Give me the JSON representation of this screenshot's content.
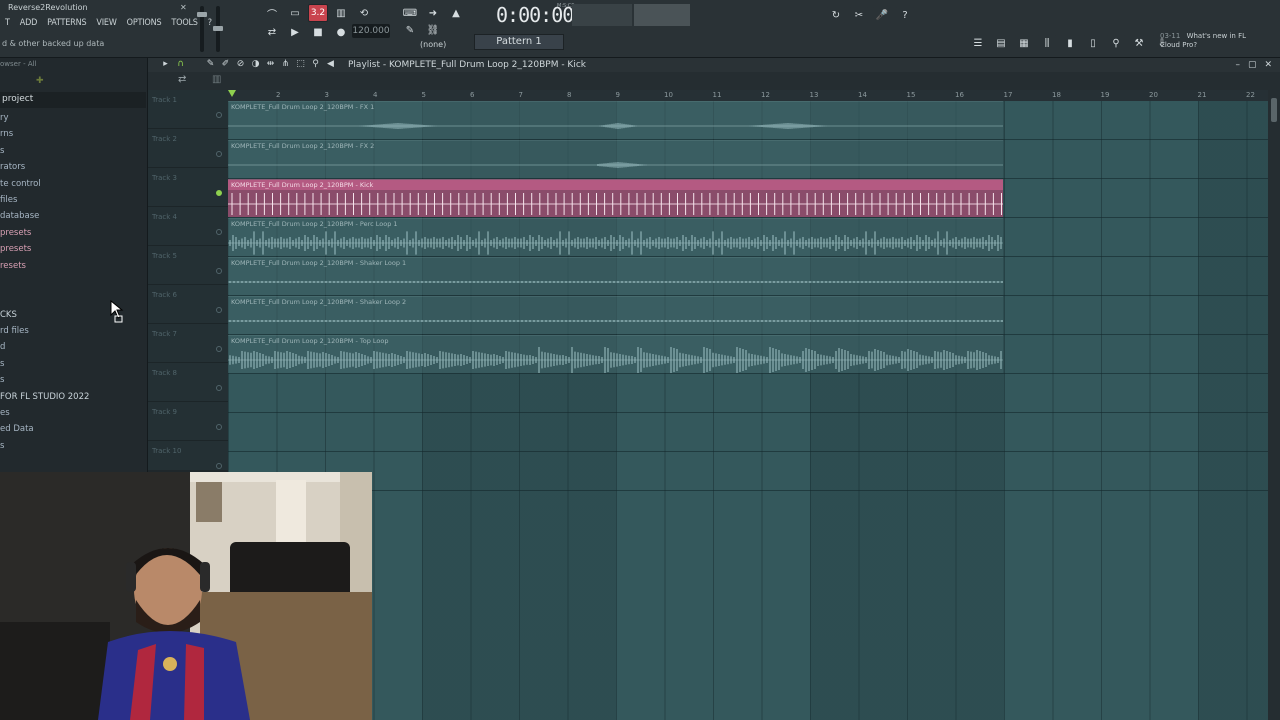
{
  "app": {
    "title": "Reverse2Revolution",
    "hint": "d & other backed up data"
  },
  "menu": [
    "T",
    "ADD",
    "PATTERNS",
    "VIEW",
    "OPTIONS",
    "TOOLS",
    "?"
  ],
  "toolbar": {
    "pat_song_label": "3.2",
    "tempo": "120.000",
    "time": "0:00:00",
    "msc_label": "M:S:CS",
    "pattern_none": "(none)",
    "pattern": "Pattern 1",
    "news_date": "03-11",
    "news_text": "What's new in FL Cloud Pro?"
  },
  "browser": {
    "header": "owser - All",
    "project": "project",
    "items": [
      {
        "label": "ry",
        "style": "normal"
      },
      {
        "label": "rns",
        "style": "normal"
      },
      {
        "label": "s",
        "style": "normal"
      },
      {
        "label": "rators",
        "style": "normal"
      },
      {
        "label": "te control",
        "style": "normal"
      },
      {
        "label": "files",
        "style": "normal"
      },
      {
        "label": "database",
        "style": "normal"
      },
      {
        "label": "presets",
        "style": "pink"
      },
      {
        "label": "presets",
        "style": "pink"
      },
      {
        "label": "resets",
        "style": "pink"
      },
      {
        "label": "",
        "style": "normal"
      },
      {
        "label": "",
        "style": "normal"
      },
      {
        "label": "CKS",
        "style": "strong"
      },
      {
        "label": "rd files",
        "style": "normal"
      },
      {
        "label": "d",
        "style": "normal"
      },
      {
        "label": "s",
        "style": "normal"
      },
      {
        "label": "s",
        "style": "normal"
      },
      {
        "label": "FOR FL STUDIO 2022",
        "style": "strong"
      },
      {
        "label": "es",
        "style": "normal"
      },
      {
        "label": "ed Data",
        "style": "normal"
      },
      {
        "label": "s",
        "style": "normal"
      }
    ]
  },
  "playlist": {
    "title": "Playlist - KOMPLETE_Full Drum Loop 2_120BPM - Kick",
    "ruler": [
      "2",
      "3",
      "4",
      "5",
      "6",
      "7",
      "8",
      "9",
      "10",
      "11",
      "12",
      "13",
      "14",
      "15",
      "16",
      "17",
      "18",
      "19",
      "20",
      "21",
      "22"
    ],
    "tracks": [
      {
        "name": "Track 1",
        "clip": "KOMPLETE_Full Drum Loop 2_120BPM - FX 1",
        "wave": "fx1",
        "active": false
      },
      {
        "name": "Track 2",
        "clip": "KOMPLETE_Full Drum Loop 2_120BPM - FX 2",
        "wave": "fx2",
        "active": false
      },
      {
        "name": "Track 3",
        "clip": "KOMPLETE_Full Drum Loop 2_120BPM - Kick",
        "wave": "kick",
        "active": true
      },
      {
        "name": "Track 4",
        "clip": "KOMPLETE_Full Drum Loop 2_120BPM - Perc Loop 1",
        "wave": "perc",
        "active": false
      },
      {
        "name": "Track 5",
        "clip": "KOMPLETE_Full Drum Loop 2_120BPM - Shaker Loop 1",
        "wave": "shaker",
        "active": false
      },
      {
        "name": "Track 6",
        "clip": "KOMPLETE_Full Drum Loop 2_120BPM - Shaker Loop 2",
        "wave": "shaker",
        "active": false
      },
      {
        "name": "Track 7",
        "clip": "KOMPLETE_Full Drum Loop 2_120BPM - Top Loop",
        "wave": "top",
        "active": false
      },
      {
        "name": "Track 8",
        "clip": "",
        "wave": "",
        "active": false
      },
      {
        "name": "Track 9",
        "clip": "",
        "wave": "",
        "active": false
      },
      {
        "name": "Track 10",
        "clip": "",
        "wave": "",
        "active": false
      }
    ]
  },
  "colors": {
    "accent_green": "#8fd14f",
    "kick_clip": "#b45a82",
    "tempo_red": "#c9444e",
    "grid": "#34585c"
  }
}
